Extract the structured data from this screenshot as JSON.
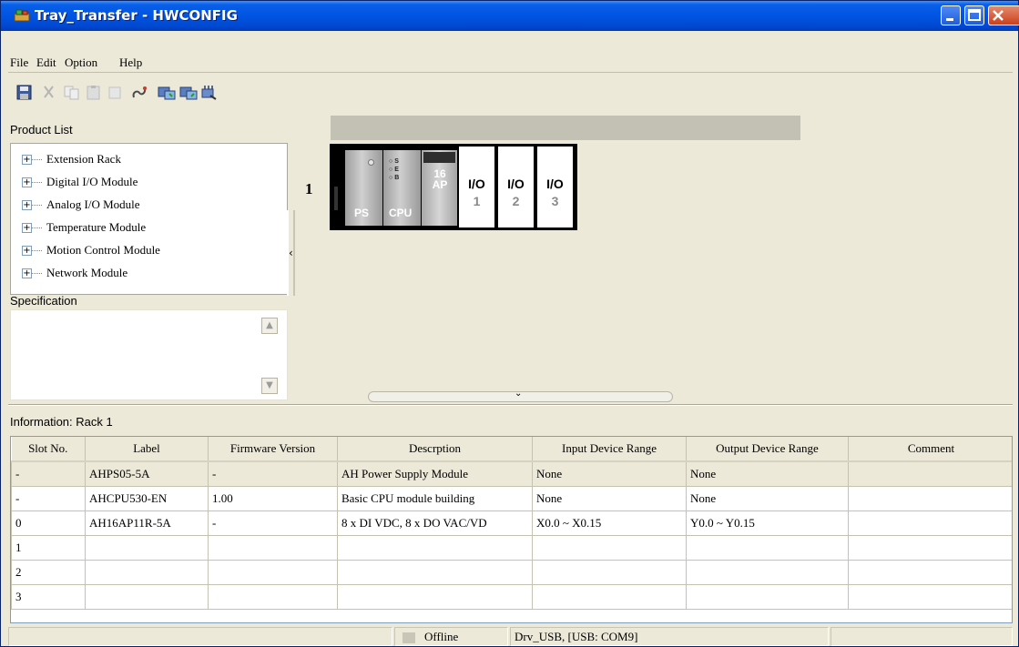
{
  "window": {
    "title": "Tray_Transfer - HWCONFIG"
  },
  "menu": {
    "items": [
      "File",
      "Edit",
      "Option",
      "Help"
    ]
  },
  "toolbar": {
    "icons": [
      "save-icon",
      "cut-icon",
      "copy-icon",
      "paste-icon",
      "delete-icon",
      "link-icon",
      "upload-icon",
      "download-icon",
      "scan-icon"
    ]
  },
  "product_list": {
    "header": "Product List",
    "items": [
      "Extension Rack",
      "Digital I/O Module",
      "Analog I/O Module",
      "Temperature Module",
      "Motion Control Module",
      "Network Module"
    ]
  },
  "specification": {
    "header": "Specification"
  },
  "rack": {
    "number": "1",
    "slots": [
      {
        "kind": "ps",
        "label": "PS"
      },
      {
        "kind": "cpu",
        "label": "CPU"
      },
      {
        "kind": "module",
        "label": "16\nAP"
      },
      {
        "kind": "io",
        "label": "I/O",
        "num": "1"
      },
      {
        "kind": "io",
        "label": "I/O",
        "num": "2"
      },
      {
        "kind": "io",
        "label": "I/O",
        "num": "3"
      }
    ],
    "cpu_leds": [
      "S",
      "E",
      "B"
    ]
  },
  "info": {
    "header": "Information: Rack 1",
    "columns": [
      "Slot No.",
      "Label",
      "Firmware Version",
      "Descrption",
      "Input Device Range",
      "Output Device Range",
      "Comment"
    ],
    "rows": [
      [
        "-",
        "AHPS05-5A",
        "-",
        "AH Power Supply Module",
        "None",
        "None",
        ""
      ],
      [
        "-",
        "AHCPU530-EN",
        "1.00",
        "Basic CPU module building",
        "None",
        "None",
        ""
      ],
      [
        "0",
        "AH16AP11R-5A",
        "-",
        "8 x DI VDC, 8 x DO VAC/VD",
        "X0.0 ~ X0.15",
        "Y0.0 ~ Y0.15",
        ""
      ],
      [
        "1",
        "",
        "",
        "",
        "",
        "",
        ""
      ],
      [
        "2",
        "",
        "",
        "",
        "",
        "",
        ""
      ],
      [
        "3",
        "",
        "",
        "",
        "",
        "",
        ""
      ]
    ]
  },
  "status": {
    "connection": "Offline",
    "driver": "Drv_USB, [USB: COM9]"
  }
}
